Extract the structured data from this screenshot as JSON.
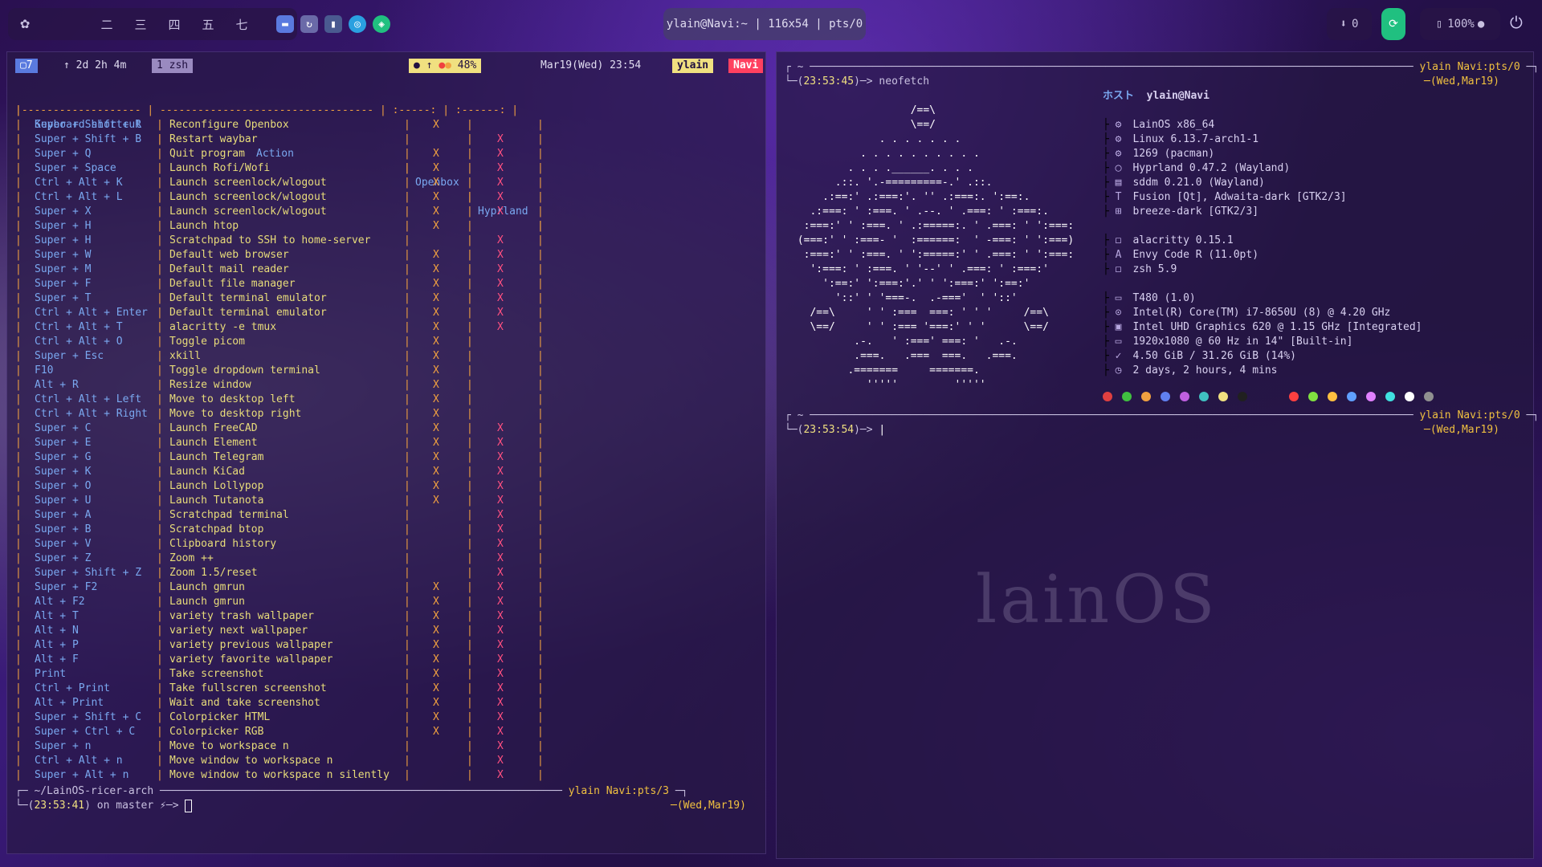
{
  "topbar": {
    "workspaces": [
      "二",
      "三",
      "四",
      "五",
      "七"
    ],
    "window_title": "ylain@Navi:~ | 116x54 | pts/0",
    "updates_count": "0",
    "volume": "100%"
  },
  "left_terminal": {
    "powerline": {
      "window_num": "7",
      "uptime": "↑ 2d 2h 4m",
      "shell": "1 zsh",
      "battery": "48%",
      "datetime": "Mar19(Wed) 23:54",
      "user": "ylain",
      "host": "Navi"
    },
    "table_headers": {
      "shortcut": "Keyboard shortcut",
      "action": "Action",
      "openbox": "Openbox",
      "hyprland": "Hyprland"
    },
    "rows": [
      {
        "k": "Super + Shift + R",
        "a": "Reconfigure Openbox",
        "o": "X",
        "h": ""
      },
      {
        "k": "Super + Shift + B",
        "a": "Restart waybar",
        "o": "",
        "h": "X"
      },
      {
        "k": "Super + Q",
        "a": "Quit program",
        "o": "X",
        "h": "X"
      },
      {
        "k": "Super + Space",
        "a": "Launch Rofi/Wofi",
        "o": "X",
        "h": "X"
      },
      {
        "k": "Ctrl + Alt + K",
        "a": "Launch screenlock/wlogout",
        "o": "X",
        "h": "X"
      },
      {
        "k": "Ctrl + Alt + L",
        "a": "Launch screenlock/wlogout",
        "o": "X",
        "h": "X"
      },
      {
        "k": "Super + X",
        "a": "Launch screenlock/wlogout",
        "o": "X",
        "h": "X"
      },
      {
        "k": "Super + H",
        "a": "Launch htop",
        "o": "X",
        "h": ""
      },
      {
        "k": "Super + H",
        "a": "Scratchpad to SSH to home-server",
        "o": "",
        "h": "X"
      },
      {
        "k": "Super + W",
        "a": "Default web browser",
        "o": "X",
        "h": "X"
      },
      {
        "k": "Super + M",
        "a": "Default mail reader",
        "o": "X",
        "h": "X"
      },
      {
        "k": "Super + F",
        "a": "Default file manager",
        "o": "X",
        "h": "X"
      },
      {
        "k": "Super + T",
        "a": "Default terminal emulator",
        "o": "X",
        "h": "X"
      },
      {
        "k": "Ctrl + Alt + Enter",
        "a": "Default terminal emulator",
        "o": "X",
        "h": "X"
      },
      {
        "k": "Ctrl + Alt + T",
        "a": "alacritty -e tmux",
        "o": "X",
        "h": "X"
      },
      {
        "k": "Ctrl + Alt + O",
        "a": "Toggle picom",
        "o": "X",
        "h": ""
      },
      {
        "k": "Super + Esc",
        "a": "xkill",
        "o": "X",
        "h": ""
      },
      {
        "k": "F10",
        "a": "Toggle dropdown terminal",
        "o": "X",
        "h": ""
      },
      {
        "k": "Alt + R",
        "a": "Resize window",
        "o": "X",
        "h": ""
      },
      {
        "k": "Ctrl + Alt + Left",
        "a": "Move to desktop left",
        "o": "X",
        "h": ""
      },
      {
        "k": "Ctrl + Alt + Right",
        "a": "Move to desktop right",
        "o": "X",
        "h": ""
      },
      {
        "k": "Super + C",
        "a": "Launch FreeCAD",
        "o": "X",
        "h": "X"
      },
      {
        "k": "Super + E",
        "a": "Launch Element",
        "o": "X",
        "h": "X"
      },
      {
        "k": "Super + G",
        "a": "Launch Telegram",
        "o": "X",
        "h": "X"
      },
      {
        "k": "Super + K",
        "a": "Launch KiCad",
        "o": "X",
        "h": "X"
      },
      {
        "k": "Super + O",
        "a": "Launch Lollypop",
        "o": "X",
        "h": "X"
      },
      {
        "k": "Super + U",
        "a": "Launch Tutanota",
        "o": "X",
        "h": "X"
      },
      {
        "k": "Super + A",
        "a": "Scratchpad terminal",
        "o": "",
        "h": "X"
      },
      {
        "k": "Super + B",
        "a": "Scratchpad btop",
        "o": "",
        "h": "X"
      },
      {
        "k": "Super + V",
        "a": "Clipboard history",
        "o": "",
        "h": "X"
      },
      {
        "k": "Super + Z",
        "a": "Zoom ++",
        "o": "",
        "h": "X"
      },
      {
        "k": "Super + Shift + Z",
        "a": "Zoom 1.5/reset",
        "o": "",
        "h": "X"
      },
      {
        "k": "Super + F2",
        "a": "Launch gmrun",
        "o": "X",
        "h": "X"
      },
      {
        "k": "Alt + F2",
        "a": "Launch gmrun",
        "o": "X",
        "h": "X"
      },
      {
        "k": "Alt + T",
        "a": "variety trash wallpaper",
        "o": "X",
        "h": "X"
      },
      {
        "k": "Alt + N",
        "a": "variety next wallpaper",
        "o": "X",
        "h": "X"
      },
      {
        "k": "Alt + P",
        "a": "variety previous wallpaper",
        "o": "X",
        "h": "X"
      },
      {
        "k": "Alt + F",
        "a": "variety favorite wallpaper",
        "o": "X",
        "h": "X"
      },
      {
        "k": "Print",
        "a": "Take screenshot",
        "o": "X",
        "h": "X"
      },
      {
        "k": "Ctrl + Print",
        "a": "Take fullscren screenshot",
        "o": "X",
        "h": "X"
      },
      {
        "k": "Alt + Print",
        "a": "Wait and take screenshot",
        "o": "X",
        "h": "X"
      },
      {
        "k": "Super + Shift + C",
        "a": "Colorpicker HTML",
        "o": "X",
        "h": "X"
      },
      {
        "k": "Super + Ctrl + C",
        "a": "Colorpicker RGB",
        "o": "X",
        "h": "X"
      },
      {
        "k": "Super + n",
        "a": "Move to workspace n",
        "o": "",
        "h": "X"
      },
      {
        "k": "Ctrl + Alt + n",
        "a": "Move window to workspace n",
        "o": "",
        "h": "X"
      },
      {
        "k": "Super + Alt + n",
        "a": "Move window to workspace n silently",
        "o": "",
        "h": "X"
      }
    ],
    "cwd": "~/LainOS-ricer-arch",
    "prompt_time": "23:53:41",
    "branch_text": "on master",
    "user_host": "ylain Navi:pts/3",
    "date": "Wed,Mar19"
  },
  "right_terminal": {
    "home": "~",
    "user_host": "ylain Navi:pts/0",
    "date": "Wed,Mar19",
    "prompt_time_1": "23:53:45",
    "command": "neofetch",
    "prompt_time_2": "23:53:54",
    "host_label": "ホスト",
    "user_at_host": "ylain@Navi",
    "info": [
      "LainOS x86_64",
      "Linux 6.13.7-arch1-1",
      "1269 (pacman)",
      "Hyprland 0.47.2 (Wayland)",
      "sddm 0.21.0 (Wayland)",
      "Fusion [Qt], Adwaita-dark [GTK2/3]",
      "breeze-dark [GTK2/3]",
      "alacritty 0.15.1",
      "Envy Code R (11.0pt)",
      "zsh 5.9",
      "T480 (1.0)",
      "Intel(R) Core(TM) i7-8650U (8) @ 4.20 GHz",
      "Intel UHD Graphics 620 @ 1.15 GHz [Integrated]",
      "1920x1080 @ 60 Hz in 14\" [Built-in]",
      "4.50 GiB / 31.26 GiB (14%)",
      "2 days, 2 hours, 4 mins"
    ],
    "ascii_art": [
      "                   /==\\",
      "                   \\==/",
      "              . . . . . . .",
      "           . . . . . . . . . .",
      "         . . . .______. . . .",
      "       .::. '.-=========-.' .::.",
      "     .:==:' .:===:'. '' .:===:. ':==:.",
      "   .:===: ' :===. ' .--. ' .===: ' :===:.",
      "  :===:' ' :===. ' .:=====:. ' .===: ' ':===:",
      " (===:' ' :===- '  :======:  ' -===: ' ':===)",
      "  :===:' ' :===. ' ':=====:' ' .===: ' ':===:",
      "   ':===: ' :===. ' '--' ' .===: ' :===:'",
      "     ':==:' ':===:'.' ' ':===:' ':==:'",
      "       '::' ' '===-.  .-==='  ' '::'",
      "   /==\\     ' ' :===  ===: ' ' '     /==\\",
      "   \\==/     ' ' :=== '===:' ' '      \\==/",
      "          .-.   ' :===' ===: '   .-.",
      "          .===.   .===  ===.   .===.",
      "         .=======     =======.",
      "            '''''         '''''"
    ],
    "palette": [
      "#e04040",
      "#40c040",
      "#f0a040",
      "#6080f0",
      "#c060e0",
      "#40c0c0",
      "#f0e080",
      "#202020",
      "#ff4040",
      "#80e040",
      "#ffc040",
      "#60a0ff",
      "#e080ff",
      "#40e0e0",
      "#ffffff",
      "#909090"
    ]
  },
  "watermark": "lainOS"
}
